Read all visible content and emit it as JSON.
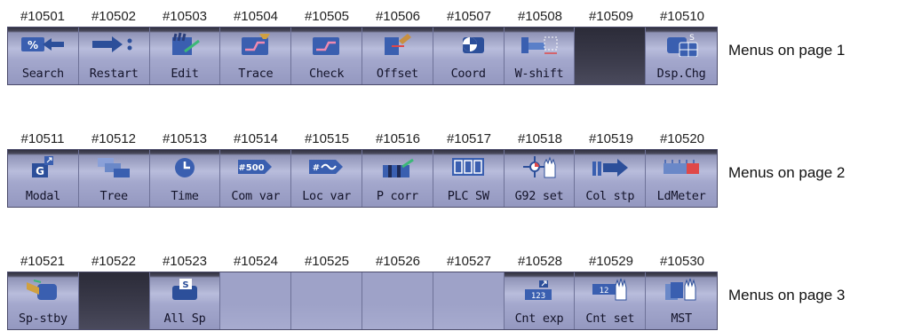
{
  "pages": [
    {
      "caption": "Menus on page 1",
      "ids": [
        "#10501",
        "#10502",
        "#10503",
        "#10504",
        "#10505",
        "#10506",
        "#10507",
        "#10508",
        "#10509",
        "#10510"
      ],
      "keys": [
        {
          "label": "Search",
          "icon": "search-icon"
        },
        {
          "label": "Restart",
          "icon": "restart-icon"
        },
        {
          "label": "Edit",
          "icon": "edit-icon"
        },
        {
          "label": "Trace",
          "icon": "trace-icon"
        },
        {
          "label": "Check",
          "icon": "check-icon"
        },
        {
          "label": "Offset",
          "icon": "offset-icon"
        },
        {
          "label": "Coord",
          "icon": "coord-icon"
        },
        {
          "label": "W-shift",
          "icon": "w-shift-icon"
        },
        {
          "label": "",
          "icon": ""
        },
        {
          "label": "Dsp.Chg",
          "icon": "display-change-icon"
        }
      ]
    },
    {
      "caption": "Menus on page 2",
      "ids": [
        "#10511",
        "#10512",
        "#10513",
        "#10514",
        "#10515",
        "#10516",
        "#10517",
        "#10518",
        "#10519",
        "#10520"
      ],
      "keys": [
        {
          "label": "Modal",
          "icon": "modal-icon",
          "icon_text": "G"
        },
        {
          "label": "Tree",
          "icon": "tree-icon"
        },
        {
          "label": "Time",
          "icon": "time-icon"
        },
        {
          "label": "Com var",
          "icon": "common-variable-icon",
          "icon_text": "#500"
        },
        {
          "label": "Loc var",
          "icon": "local-variable-icon",
          "icon_text": "#"
        },
        {
          "label": "P corr",
          "icon": "p-correction-icon"
        },
        {
          "label": "PLC SW",
          "icon": "plc-switch-icon"
        },
        {
          "label": "G92 set",
          "icon": "g92-set-icon"
        },
        {
          "label": "Col stp",
          "icon": "collation-stop-icon"
        },
        {
          "label": "LdMeter",
          "icon": "load-meter-icon"
        }
      ]
    },
    {
      "caption": "Menus on page 3",
      "ids": [
        "#10521",
        "#10522",
        "#10523",
        "#10524",
        "#10525",
        "#10526",
        "#10527",
        "#10528",
        "#10529",
        "#10530"
      ],
      "keys": [
        {
          "label": "Sp-stby",
          "icon": "spindle-standby-icon"
        },
        {
          "label": "",
          "icon": ""
        },
        {
          "label": "All Sp",
          "icon": "all-spindle-icon",
          "icon_text": "S"
        },
        {
          "label": "",
          "icon": ""
        },
        {
          "label": "",
          "icon": ""
        },
        {
          "label": "",
          "icon": ""
        },
        {
          "label": "",
          "icon": ""
        },
        {
          "label": "Cnt exp",
          "icon": "counter-expand-icon",
          "icon_text": "123"
        },
        {
          "label": "Cnt set",
          "icon": "counter-set-icon",
          "icon_text": "12"
        },
        {
          "label": "MST",
          "icon": "mst-icon"
        }
      ]
    }
  ],
  "colors": {
    "bar_top": "#303040",
    "bar_body": "#a4a8cd",
    "icon_blue": "#3a5fb0",
    "icon_green": "#3cb878",
    "icon_red": "#e04848"
  }
}
